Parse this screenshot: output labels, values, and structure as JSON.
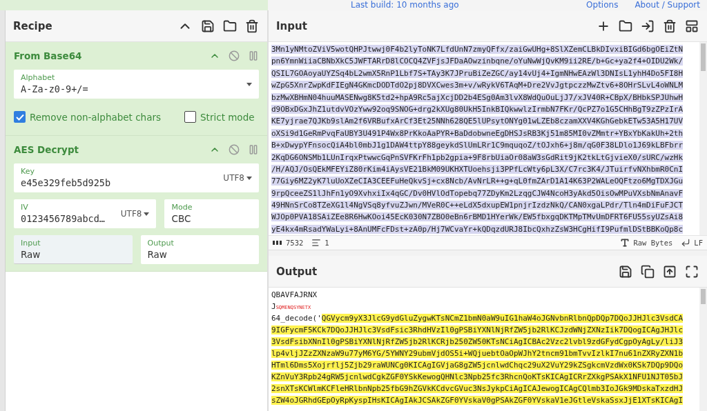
{
  "top_bar": {
    "build_info": "Last build: 10 months ago",
    "links": [
      "Options",
      "About / Support"
    ]
  },
  "recipe": {
    "title": "Recipe",
    "operations": [
      {
        "name": "From Base64",
        "rows": [
          [
            {
              "kind": "dropdown",
              "label": "Alphabet",
              "value": "A-Za-z0-9+/="
            }
          ],
          [
            {
              "kind": "checkbox",
              "label": "Remove non-alphabet chars",
              "checked": true
            },
            {
              "kind": "checkbox",
              "label": "Strict mode",
              "checked": false
            }
          ]
        ]
      },
      {
        "name": "AES Decrypt",
        "rows": [
          [
            {
              "kind": "toggle_string",
              "label": "Key",
              "value": "e45e329feb5d925b",
              "encoding": "UTF8"
            }
          ],
          [
            {
              "kind": "toggle_string",
              "label": "IV",
              "value": "0123456789abcd…",
              "encoding": "UTF8"
            },
            {
              "kind": "option",
              "label": "Mode",
              "value": "CBC",
              "shaded": false
            }
          ],
          [
            {
              "kind": "option",
              "label": "Input",
              "value": "Raw",
              "shaded": true
            },
            {
              "kind": "option",
              "label": "Output",
              "value": "Raw",
              "shaded": false
            }
          ]
        ]
      }
    ]
  },
  "input": {
    "title": "Input",
    "selected": true,
    "lines": [
      "3Mn1yNMtoZViV5wotQHPJtwwj0F4b2lyToNK7LfdUnN7zmyQFfx/zaiGwUHg+8SlXZemCLBkDIvxiBIGd6bgOEiZtN",
      "pn6YmnWiiaCBNbXkC5JWFTARrD8lCOCQ4ZVFjsJFDaAOwzinbqne/oYuNwWjQvKM9ii2RE/b+Gc+ya2f4+OIDU2Wk/",
      "QSIL7GOAoyaUYZSq4bL2wmX5RnP1Lbf7S+TAy3K7JPruBiZeZGC/ay14vUj4+IgmNHwEAzWl3DNIsL1yhH4Do5FI8H",
      "wZpG5XnrZwpKdFIEgN4GKmcDODTdO2pj8DVXCwes3m+v/wRykV6TAqM+Dre2VvJgtpczzMwZtv6+8OHrSLvL4oWNLM",
      "bzMwXBHmN04huuMASENwg8K5td2+hpA9Rc5ajXcjDD2b4ESg0Am3lvX8WdQuOuLjJ7/xJV40R+CBpX/BHbkSPJUhwH",
      "d9OBxDGxJhZ1utdvVOzYww92oq9SNOG+drg2kXUg80UkH5InkBIQkwwlzIrmbN7FKr/QcPZ7o1G5CHhBgT9zZPzIrA",
      "KE7yjrae7QJKb9slAm2f6VRBufxArCf3Et25NNh628QE5lUPsytONYg01wLZEb8czamXXV4KGhGebkETw53A5H17UV",
      "oXSi9d1GeRmPvqFaUBY3U491P4Wx8PrKkoAaPYR+BaDdobwneEgDHSJsRB3Kj51m85MI0vZMmtr+YBxYbKakUh+2th",
      "B+xDwypYFnsocQiA4bl0mbJ1g1DAW4ttpY88geykdSlUmLRr1C9mquqoZ/tOJxh6+j8m/qG0F38LDlo1J69kLBFbrr",
      "2KqDG6ONSMb1LUnIrqxPtwwcGqPnSVFKrFh1pb2gpia+9F8rbUiaOr08aW3sGdRit9jK2tkLtGjvieX0/sURC/wzHk",
      "/H/AQJ/OsQEkMFEYiZ80rKim4iAysVE21BkM09UKHXTUoehsji3PPfLcWty6pL3X/C7rc3K4/JTuirfvNXhbmR0CnI",
      "77Giy6MZ2yK7luUoXZeCIA3CEEFuHeQkvSj+cx8Ncb/AvNrLR++g+qL0fmZArD1A14K63P2WALeOQFtzo6MgTDXJGu",
      "9rpQceeZS1lJhFn1yO9XvhxiIx4qGC/Dv0HVlOdTopebq77ZDyKm2LzqgCJW4NcoH3yAkd5OisOwMPuVXsbNmAnavF",
      "49HNnSrCo8TZeXG1l4NgVSq8yfvuZJwn/MVeR0C++eLdX5dxupEW1pnjrIzdzNkQ/CAN0xgaLPdr/Tln4mDiFuFJCT",
      "WJOp0PVA18SAiZEe8R6HwKOoi45EcK030N7ZBO0eBn6rBMD1HYerWk/EW5fbxgqDKTMpTMvUmDFRT6FU55syUZsAi8",
      "yE4kx4mRsadYWaLyi+8AnUMFcFDst+zA0p/Hj7WCvaYr+kQDqzdURJ8IbcQxhzZsW3HCgHifI9PufmlDStBBKoQp8c"
    ],
    "status": {
      "length": "7532",
      "line_count": "1",
      "encoding": "Raw Bytes",
      "eol": "LF"
    }
  },
  "output": {
    "title": "Output",
    "lines": [
      [
        {
          "kind": "plain",
          "text": "QBAVFAJRNX"
        }
      ],
      [
        {
          "kind": "plain",
          "text": "J"
        },
        {
          "kind": "control",
          "text": "SQMENQSYNETX"
        }
      ],
      [
        {
          "kind": "plain",
          "text": "64_decode('"
        },
        {
          "kind": "highlight",
          "text": "QGVycm9yX3JlcG9ydGluZygwKTsNCmZ1bmN0aW9uIG1haW4oJGNvbnRlbnQpDQp7DQoJJHJlc3VsdCA"
        }
      ],
      [
        {
          "kind": "highlight",
          "text": "9IGFycmF5KCk7DQoJJHJlc3VsdFsic3RhdHVzIl0gPSBiYXNlNjRfZW5jb2RlKCJzdWNjZXNzIik7DQogICAgJHJlc"
        }
      ],
      [
        {
          "kind": "highlight",
          "text": "3VsdFsibXNnIl0gPSBiYXNlNjRfZW5jb2RlKCRjb250ZW50KTsNCiAgICBAc2Vzc2lvbl9zdGFydCgpOyAgLy/liJ3"
        }
      ],
      [
        {
          "kind": "highlight",
          "text": "lp4vljJZzZXNzaW9u77yM6YG/5YWNY29ubmVjdOS5i+WQjuebtOaOpWJhY2tncm91bmTvvIzlkI7nu61nZXRyZXN1b"
        }
      ],
      [
        {
          "kind": "highlight",
          "text": "HTml6Dms5Xojrflj5Zjb29raWUNCg0KICAgIGVjaG8gZW5jcnlwdChqc29uX2VuY29kZSgkcmVzdWx0KSk7DQp9DQo"
        }
      ],
      [
        {
          "kind": "highlight",
          "text": "KZnVuY3Rpb24gRW5jcnlwdCgkZGF0YSkKewogQHNlc3Npb25fc3RhcnQoKTsKICAgICRrZXkgPSAkX1NFU1NJT05bJ"
        }
      ],
      [
        {
          "kind": "highlight",
          "text": "2snXTsKCWlmKCFleHRlbnNpb25fbG9hZGVkKCdvcGVuc3NsJykpCiAgICAJewogICAgCQlmb3IoJGk9MDskaTxzdHJ"
        }
      ],
      [
        {
          "kind": "highlight",
          "text": "sZW4oJGRhdGEpOyRpKyspIHsKICAgIAkJCSAkZGF0YVskaV0gPSAkZGF0YVskaV1eJGtleVskaSsxJjE1XTsKICAgI"
        }
      ]
    ]
  }
}
